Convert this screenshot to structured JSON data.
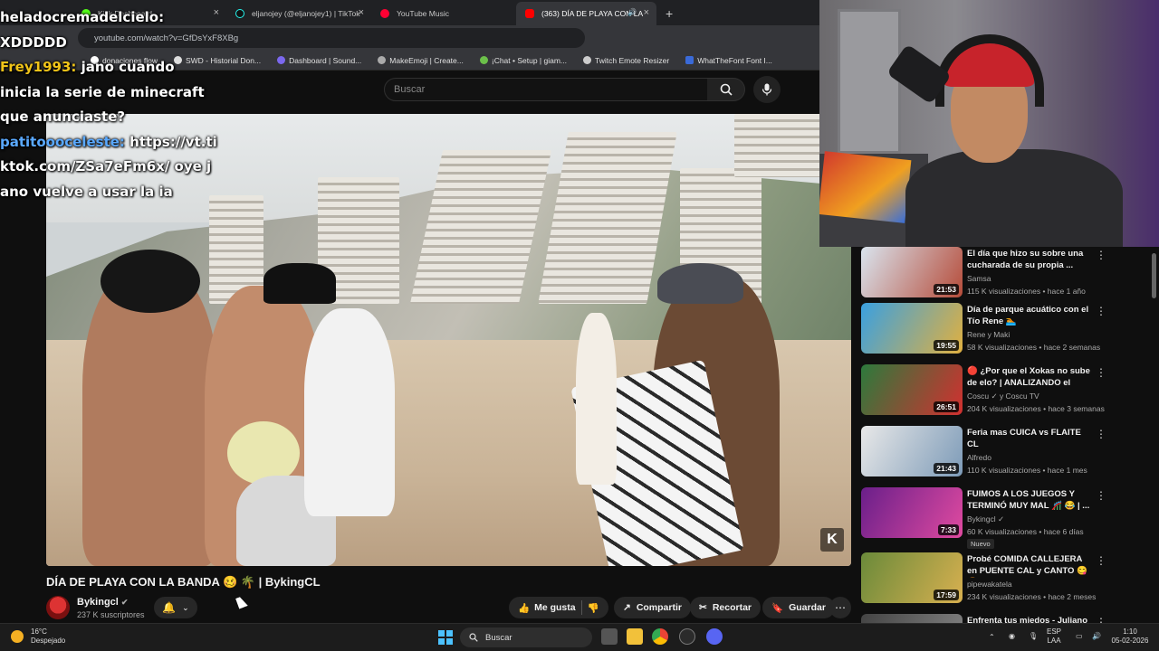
{
  "browser": {
    "tabs": [
      {
        "label": "Kick Dashboard"
      },
      {
        "label": "eljanojey (@eljanojey1) | TikTok"
      },
      {
        "label": "YouTube Music"
      },
      {
        "label": "(363) DÍA DE PLAYA CON LA"
      }
    ],
    "url": "youtube.com/watch?v=GfDsYxF8XBg",
    "bookmarks": [
      {
        "label": "donaciones flow"
      },
      {
        "label": "SWD - Historial Don..."
      },
      {
        "label": "Dashboard | Sound..."
      },
      {
        "label": "MakeEmoji | Create..."
      },
      {
        "label": "¡Chat • Setup | giam..."
      },
      {
        "label": "Twitch Emote Resizer"
      },
      {
        "label": "WhatTheFont Font I..."
      }
    ]
  },
  "chat": {
    "messages": [
      {
        "user": "heladocremadelcielo:",
        "text": "XDDDDD"
      },
      {
        "user": "Frey1993:",
        "text": "jano cuando inicia la serie de minecraft que anunciaste?"
      },
      {
        "user": "patitoooceleste:",
        "text": "https://vt.tiktok.com/ZSa7eFm6x/ oye jano vuelve a usar la ia"
      }
    ]
  },
  "youtube": {
    "search_placeholder": "Buscar",
    "video": {
      "title": "DÍA DE PLAYA CON LA BANDA 🥴 🌴 | BykingCL",
      "channel": "Bykingcl",
      "subscribers": "237 K suscriptores",
      "watermark": "K"
    },
    "actions": {
      "like": "Me gusta",
      "share": "Compartir",
      "clip": "Recortar",
      "save": "Guardar"
    },
    "recommendations": [
      {
        "title": "El día que hizo su sobre una cucharada de su propia ...",
        "channel": "Samsa",
        "meta": "115 K visualizaciones • hace 1 año",
        "duration": "21:53",
        "colors": [
          "#d9e4ee",
          "#b64c3a"
        ]
      },
      {
        "title": "Día de parque acuático con el Tío Rene 🏊",
        "channel": "Rene y Maki",
        "meta": "58 K visualizaciones • hace 2 semanas",
        "duration": "19:55",
        "colors": [
          "#3aa0e0",
          "#e0b040"
        ]
      },
      {
        "title": "🔴 ¿Por que el Xokas no sube de elo? | ANALIZANDO el ROA...",
        "channel": "Coscu ✓ y Coscu TV",
        "meta": "204 K visualizaciones • hace 3 semanas",
        "duration": "26:51",
        "colors": [
          "#2c7a3c",
          "#d23030"
        ]
      },
      {
        "title": "Feria mas CUICA vs FLAITE CL",
        "channel": "Alfredo",
        "meta": "110 K visualizaciones • hace 1 mes",
        "duration": "21:43",
        "colors": [
          "#e8e8e8",
          "#7d9bb8"
        ]
      },
      {
        "title": "FUIMOS A LOS JUEGOS Y TERMINÓ MUY MAL 🎢 😂 | ...",
        "channel": "Bykingcl ✓",
        "meta": "60 K visualizaciones • hace 6 días",
        "duration": "7:33",
        "badge": "Nuevo",
        "colors": [
          "#6a1f8a",
          "#e04aa0"
        ]
      },
      {
        "title": "Probé COMIDA CALLEJERA en PUENTE CAL y CANTO 😋 🍔",
        "channel": "pipewakatela",
        "meta": "234 K visualizaciones • hace 2 meses",
        "duration": "17:59",
        "colors": [
          "#6a8a3a",
          "#d8b050"
        ]
      },
      {
        "title": "Enfrenta tus miedos - Juliano",
        "channel": "",
        "meta": "",
        "duration": "",
        "colors": [
          "#444",
          "#888"
        ]
      }
    ]
  },
  "taskbar": {
    "weather_temp": "16°C",
    "weather_text": "Despejado",
    "search": "Buscar",
    "lang_top": "ESP",
    "lang_bottom": "LAA",
    "time": "1:10",
    "date": "05-02-2026"
  }
}
